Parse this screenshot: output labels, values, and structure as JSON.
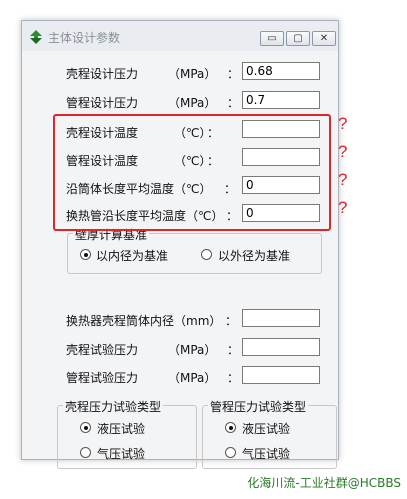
{
  "window": {
    "title": "主体设计参数",
    "buttons": {
      "minimize": "▭",
      "restore": "▢",
      "close": "✕"
    }
  },
  "fields": [
    {
      "label": "壳程设计压力",
      "unit": "（MPa）",
      "colon": "：",
      "value": "0.68"
    },
    {
      "label": "管程设计压力",
      "unit": "（MPa）",
      "colon": "：",
      "value": "0.7"
    },
    {
      "label": "壳程设计温度",
      "unit": "（℃）",
      "colon": "：",
      "value": ""
    },
    {
      "label": "管程设计温度",
      "unit": "（℃）",
      "colon": "：",
      "value": ""
    },
    {
      "label": "沿筒体长度平均温度（℃）",
      "colon": "：",
      "value": "0"
    },
    {
      "label": "换热管沿长度平均温度（℃）",
      "colon": "：",
      "value": "0"
    }
  ],
  "wall_basis": {
    "title": "壁厚计算基准",
    "options": [
      {
        "label": "以内径为基准",
        "checked": true
      },
      {
        "label": "以外径为基准",
        "checked": false
      }
    ]
  },
  "fields2": [
    {
      "label": "换热器壳程筒体内径（mm）",
      "colon": "：",
      "value": ""
    },
    {
      "label": "壳程试验压力",
      "unit": "（MPa）",
      "colon": "：",
      "value": ""
    },
    {
      "label": "管程试验压力",
      "unit": "（MPa）",
      "colon": "：",
      "value": ""
    }
  ],
  "shell_test": {
    "title": "壳程压力试验类型",
    "options": [
      {
        "label": "液压试验",
        "checked": true
      },
      {
        "label": "气压试验",
        "checked": false
      }
    ]
  },
  "tube_test": {
    "title": "管程压力试验类型",
    "options": [
      {
        "label": "液压试验",
        "checked": true
      },
      {
        "label": "气压试验",
        "checked": false
      }
    ]
  },
  "annotation": {
    "marks": [
      "?",
      "?",
      "?",
      "?"
    ],
    "color": "#e0262a"
  },
  "watermark": "化海川流-工业社群@HCBBS"
}
